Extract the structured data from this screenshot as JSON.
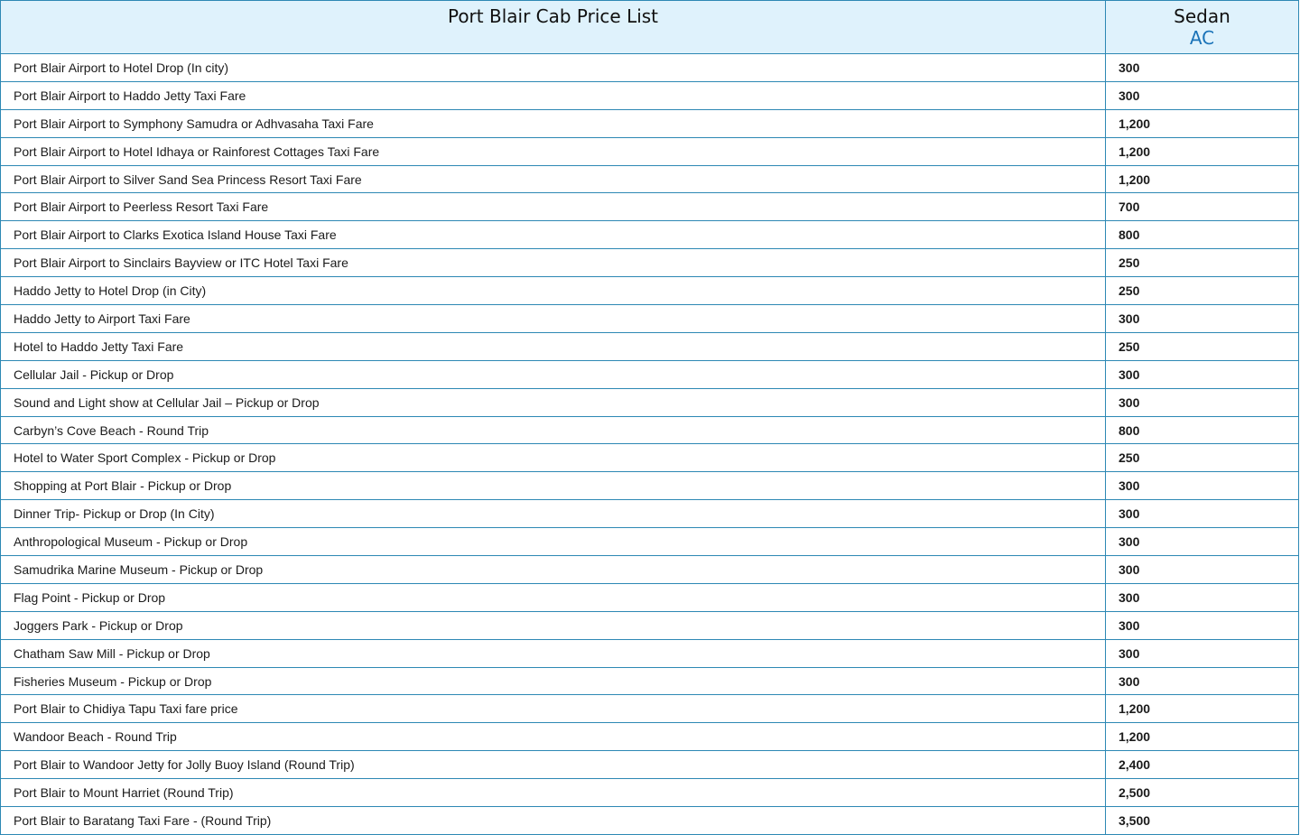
{
  "table": {
    "title": "Port Blair Cab Price List",
    "vehicle": "Sedan",
    "vehicle_class": "AC",
    "rows": [
      {
        "route": "Port Blair Airport to Hotel Drop (In city)",
        "price": "300"
      },
      {
        "route": "Port Blair Airport to Haddo Jetty Taxi Fare",
        "price": "300"
      },
      {
        "route": "Port Blair Airport to Symphony Samudra or Adhvasaha Taxi Fare",
        "price": "1,200"
      },
      {
        "route": "Port Blair Airport to Hotel Idhaya or Rainforest Cottages Taxi Fare",
        "price": "1,200"
      },
      {
        "route": "Port Blair Airport to Silver Sand Sea Princess Resort Taxi Fare",
        "price": "1,200"
      },
      {
        "route": "Port Blair Airport to Peerless Resort Taxi Fare",
        "price": "700"
      },
      {
        "route": "Port Blair Airport to Clarks Exotica Island House Taxi Fare",
        "price": "800"
      },
      {
        "route": "Port Blair Airport to Sinclairs Bayview or ITC Hotel Taxi Fare",
        "price": "250"
      },
      {
        "route": "Haddo Jetty to Hotel Drop (in City)",
        "price": "250"
      },
      {
        "route": "Haddo Jetty to Airport Taxi Fare",
        "price": "300"
      },
      {
        "route": "Hotel to Haddo Jetty Taxi Fare",
        "price": "250"
      },
      {
        "route": "Cellular Jail - Pickup or Drop",
        "price": "300"
      },
      {
        "route": "Sound and Light show at Cellular Jail – Pickup or Drop",
        "price": "300"
      },
      {
        "route": "Carbyn’s Cove Beach - Round Trip",
        "price": "800"
      },
      {
        "route": "Hotel to Water Sport Complex - Pickup or Drop",
        "price": "250"
      },
      {
        "route": "Shopping at Port Blair - Pickup or Drop",
        "price": "300"
      },
      {
        "route": "Dinner Trip- Pickup or Drop (In City)",
        "price": "300"
      },
      {
        "route": "Anthropological Museum - Pickup or Drop",
        "price": "300"
      },
      {
        "route": "Samudrika Marine Museum - Pickup or Drop",
        "price": "300"
      },
      {
        "route": "Flag Point - Pickup or Drop",
        "price": "300"
      },
      {
        "route": "Joggers Park - Pickup or Drop",
        "price": "300"
      },
      {
        "route": "Chatham Saw Mill - Pickup or Drop",
        "price": "300"
      },
      {
        "route": "Fisheries Museum - Pickup or Drop",
        "price": "300"
      },
      {
        "route": "Port Blair to Chidiya Tapu Taxi fare price",
        "price": "1,200"
      },
      {
        "route": "Wandoor Beach - Round Trip",
        "price": "1,200"
      },
      {
        "route": "Port Blair to Wandoor Jetty for Jolly Buoy Island (Round Trip)",
        "price": "2,400"
      },
      {
        "route": "Port Blair to Mount Harriet (Round Trip)",
        "price": "2,500"
      },
      {
        "route": "Port Blair to Baratang Taxi Fare - (Round Trip)",
        "price": "3,500"
      }
    ]
  },
  "colors": {
    "header_bg": "#dff2fc",
    "border": "#2d88b4",
    "accent": "#1a73b8"
  }
}
